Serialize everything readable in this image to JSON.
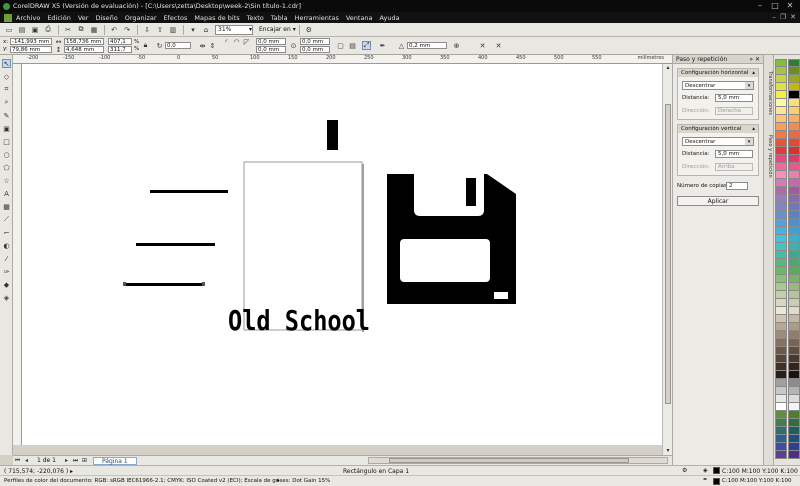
{
  "window": {
    "title": "CorelDRAW X5 (Versión de evaluación) - [C:\\Users\\zetta\\Desktop\\week-2\\Sin título-1.cdr]"
  },
  "menu": [
    "Archivo",
    "Edición",
    "Ver",
    "Diseño",
    "Organizar",
    "Efectos",
    "Mapas de bits",
    "Texto",
    "Tabla",
    "Herramientas",
    "Ventana",
    "Ayuda"
  ],
  "toolbar": {
    "zoom": "31%",
    "snap_label": "Encajar en"
  },
  "property_bar": {
    "x": "-141,993 mm",
    "y": "79,86 mm",
    "width": "158,736 mm",
    "height": "4,648 mm",
    "scale_x": "407,1",
    "scale_y": "311,7",
    "pct": "%",
    "rotation": "0,0",
    "corner_1": "0,0 mm",
    "corner_2": "0,0 mm",
    "corner_3": "0,0 mm",
    "corner_4": "0,0 mm",
    "outline_width": "0,2 mm"
  },
  "ruler": {
    "unit": "milímetros",
    "top_labels": [
      "-200",
      "-150",
      "-100",
      "-50",
      "0",
      "50",
      "100",
      "150",
      "200",
      "250",
      "300",
      "350",
      "400",
      "450",
      "500",
      "550"
    ]
  },
  "canvas": {
    "artwork_text": "Old School"
  },
  "page_nav": {
    "counter": "1 de 1",
    "page_tab": "Página 1"
  },
  "status": {
    "cursor_pos": "( 715,574; -220,076 )",
    "selection": "Rectángulo en Capa 1",
    "fill_info": "C:100 M:100 Y:100 K:100",
    "outline_info": "C:100 M:100 Y:100 K:100",
    "color_profile": "Perfiles de color del documento: RGB: sRGB IEC61966-2.1; CMYK: ISO Coated v2 (ECI); Escala de grises: Dot Gain 15%"
  },
  "docker": {
    "title": "Paso y repetición",
    "horizontal": {
      "heading": "Configuración horizontal",
      "mode": "Descentrar",
      "distance_label": "Distancia:",
      "distance": "5,0 mm",
      "direction_label": "Dirección:",
      "direction": "Derecha"
    },
    "vertical": {
      "heading": "Configuración vertical",
      "mode": "Descentrar",
      "distance_label": "Distancia:",
      "distance": "5,0 mm",
      "direction_label": "Dirección:",
      "direction": "Arriba"
    },
    "copies_label": "Número de copias:",
    "copies": "2",
    "apply": "Aplicar",
    "tabs": [
      "Transformaciones",
      "Paso y repetición"
    ]
  },
  "palette": {
    "col1": [
      "#7fbf3f",
      "#a6c24d",
      "#c6d44a",
      "#e0e04a",
      "#f4ef45",
      "#fff7a8",
      "#fce49c",
      "#f7c67c",
      "#f3a060",
      "#ef7b4a",
      "#e8543b",
      "#e33b3b",
      "#e84a7c",
      "#ec6a9e",
      "#f093b8",
      "#d47ab8",
      "#b06aa8",
      "#9a7bbf",
      "#7f86c4",
      "#6a8fd0",
      "#5a9fd8",
      "#4ab0de",
      "#48c0d8",
      "#4ac3bf",
      "#4abaa0",
      "#5ab67f",
      "#6ab86a",
      "#8cc07a",
      "#a8c890",
      "#c2d0a8",
      "#d8d8c0",
      "#ece8d8",
      "#d0c4b0",
      "#b8a890",
      "#a08c74",
      "#887060",
      "#705848",
      "#584438",
      "#403028",
      "#282018",
      "#a0a0a0",
      "#c8c8c8",
      "#e8e8e8",
      "#ffffff",
      "#5f8f3a",
      "#3f7f4f",
      "#2f6f6f",
      "#2f5f8f",
      "#3f4f9f",
      "#5f3f8f"
    ],
    "col2": [
      "#2e7d32",
      "#6a8e23",
      "#9aa81f",
      "#c0b81a",
      "#000000",
      "#f9e07a",
      "#f7d070",
      "#f4b060",
      "#f08d52",
      "#eb6a42",
      "#e24a36",
      "#d93030",
      "#de3a6a",
      "#e25a90",
      "#e682ac",
      "#c668ac",
      "#a25a9a",
      "#8a6ab0",
      "#7078b8",
      "#5a82c4",
      "#4a92cc",
      "#3aa2d4",
      "#38b2cc",
      "#3ab4b0",
      "#3aaa92",
      "#4aa870",
      "#5aaa5a",
      "#7ab06a",
      "#98b880",
      "#b4c49a",
      "#ccccb4",
      "#e0dccc",
      "#c4b8a4",
      "#ac9c84",
      "#947c68",
      "#7c6454",
      "#644c3c",
      "#4c382c",
      "#34241c",
      "#1c140c",
      "#8c8c8c",
      "#b4b4b4",
      "#dcdcdc",
      "#f4f4f4",
      "#4f7f2a",
      "#2f6f3f",
      "#1f5f5f",
      "#1f4f7f",
      "#2f3f8f",
      "#4f2f7f"
    ]
  }
}
